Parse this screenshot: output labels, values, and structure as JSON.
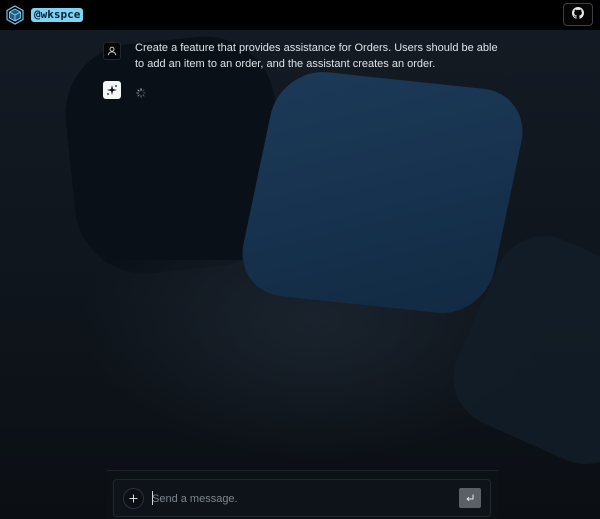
{
  "header": {
    "brand": "@wkspce",
    "logo_icon": "cube-logo-icon",
    "github_icon": "github-icon"
  },
  "conversation": [
    {
      "role": "user",
      "avatar_icon": "user-icon",
      "text": "Create a feature that provides assistance for Orders. Users should be able to add an item to an order, and the assistant creates an order."
    },
    {
      "role": "assistant",
      "avatar_icon": "sparkle-icon",
      "status_icon": "loading-spinner-icon"
    }
  ],
  "composer": {
    "placeholder": "Send a message.",
    "value": "",
    "add_icon": "plus-icon",
    "send_icon": "enter-icon"
  },
  "colors": {
    "brand_badge": "#7fd3f5",
    "top_bar": "#000000",
    "background": "#0d1117",
    "accent_shape": "#1c3a58"
  }
}
